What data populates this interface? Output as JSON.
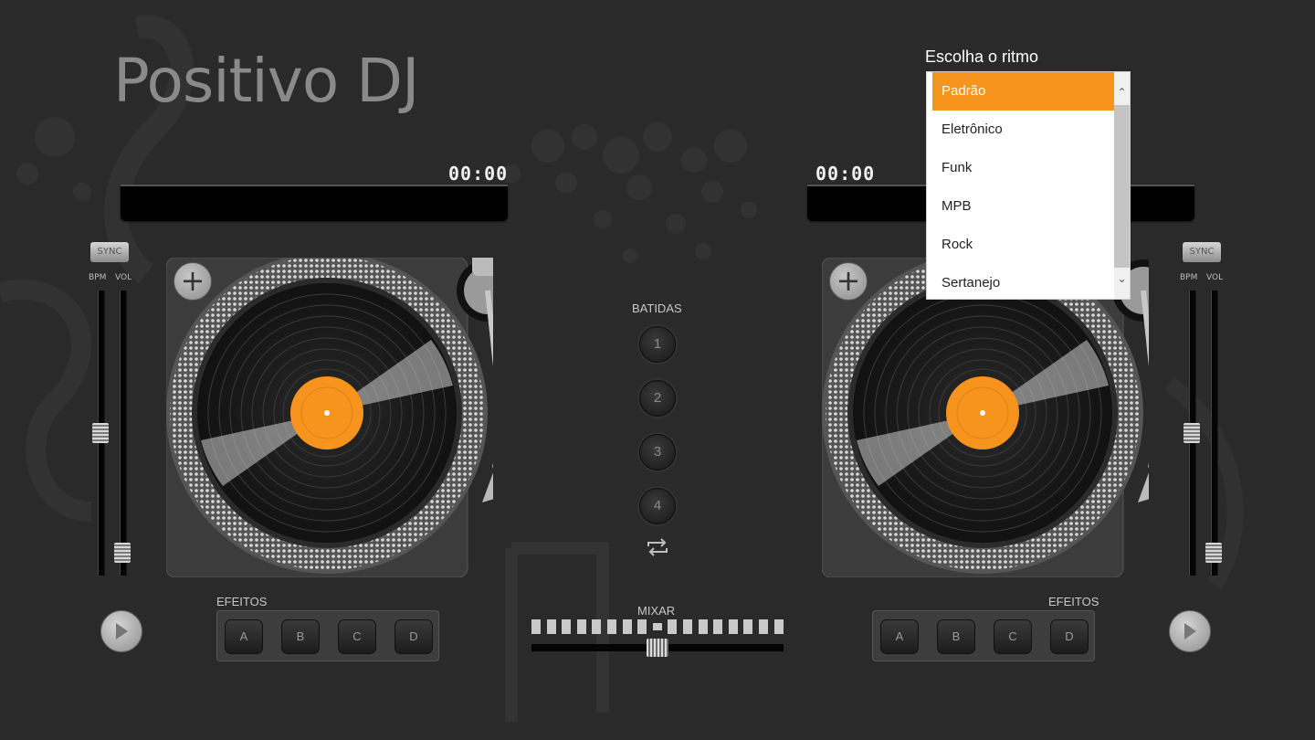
{
  "app": {
    "title": "Positivo DJ"
  },
  "deck_left": {
    "time": "00:00",
    "sync_label": "SYNC",
    "bpm_label": "BPM",
    "vol_label": "VOL",
    "bpm_level": 0.5,
    "vol_level": 0.05,
    "effects_label": "EFEITOS",
    "effects": [
      "A",
      "B",
      "C",
      "D"
    ]
  },
  "deck_right": {
    "time": "00:00",
    "sync_label": "SYNC",
    "bpm_label": "BPM",
    "vol_label": "VOL",
    "bpm_level": 0.5,
    "vol_level": 0.05,
    "effects_label": "EFEITOS",
    "effects": [
      "A",
      "B",
      "C",
      "D"
    ]
  },
  "center": {
    "beats_label": "BATIDAS",
    "beats": [
      "1",
      "2",
      "3",
      "4"
    ],
    "mixer_label": "MIXAR",
    "crossfader_position": 0.5
  },
  "rhythm": {
    "label": "Escolha o ritmo",
    "selected": "Padrão",
    "options": [
      "Padrão",
      "Eletrônico",
      "Funk",
      "MPB",
      "Rock",
      "Sertanejo"
    ]
  },
  "colors": {
    "accent": "#f7941e",
    "background": "#2a2a2a"
  },
  "icons": {
    "add": "plus-icon",
    "play": "play-icon",
    "repeat": "repeat-icon"
  }
}
